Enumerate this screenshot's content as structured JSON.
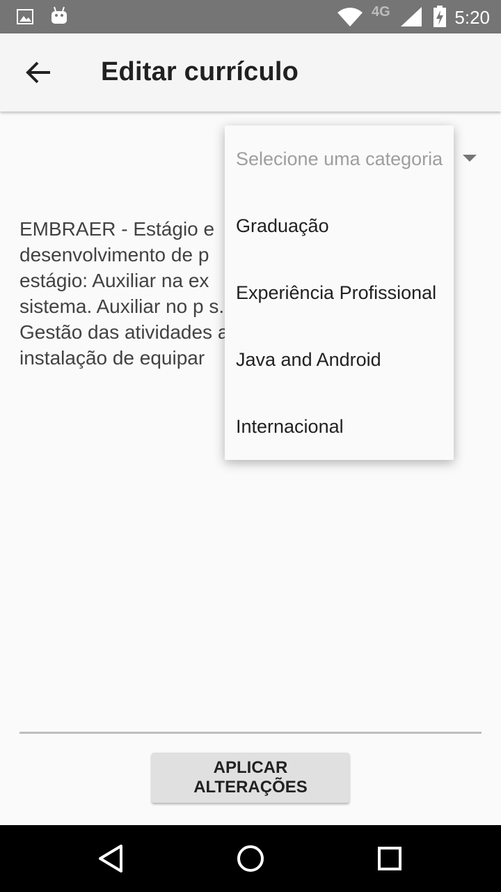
{
  "status_bar": {
    "time": "5:20",
    "network": "4G",
    "icons": [
      "image-icon",
      "android-icon",
      "wifi-icon",
      "signal-icon",
      "battery-charging-icon"
    ]
  },
  "app_bar": {
    "title": "Editar currículo",
    "back_icon": "arrow-back-icon"
  },
  "category_spinner": {
    "hint": "Selecione uma categoria",
    "options": [
      "Graduação",
      "Experiência Profissional",
      "Java and Android",
      "Internacional"
    ]
  },
  "description_text": "EMBRAER - Estágio e\ndesenvolvimento de p\nestágio: Auxiliar na ex\nsistema. Auxiliar no p                                        s.\nGestão das atividades                                        ar\ninstalação de equipar",
  "apply_button": "APLICAR ALTERAÇÕES",
  "nav_bar": {
    "icons": [
      "back-triangle-icon",
      "home-circle-icon",
      "recents-square-icon"
    ]
  },
  "colors": {
    "status_bar": "#757575",
    "app_bar": "#f5f5f5",
    "background": "#fafafa",
    "button": "#e0e0e0"
  }
}
